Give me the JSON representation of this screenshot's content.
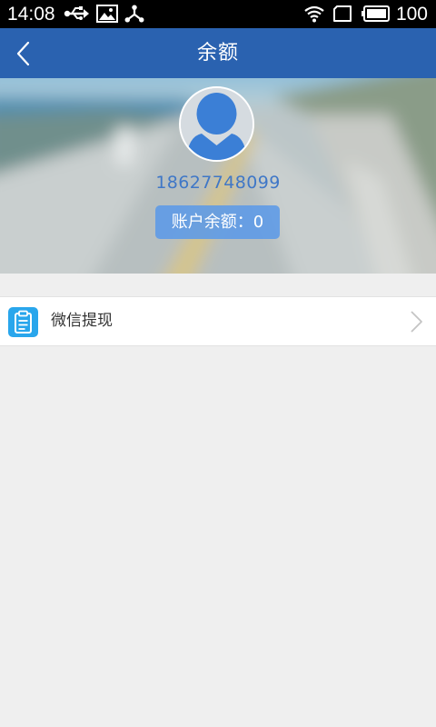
{
  "status_bar": {
    "time": "14:08",
    "battery": "100",
    "left_icons": [
      "usb-icon",
      "image-icon",
      "share-icon"
    ],
    "right_icons": [
      "wifi-icon",
      "sim-icon",
      "battery-icon"
    ]
  },
  "header": {
    "title": "余额",
    "back_icon": "chevron-left-icon",
    "background_color": "#2a62b0"
  },
  "account": {
    "phone": "18627748099",
    "balance_label": "账户余额：0",
    "avatar_icon": "user-avatar-icon"
  },
  "menu": {
    "items": [
      {
        "label": "微信提现",
        "icon": "clipboard-icon",
        "icon_color": "#29a6ec",
        "trailing_icon": "chevron-right-icon"
      }
    ]
  },
  "colors": {
    "accent": "#2a62b0",
    "phone_text": "#3f77c7",
    "badge": "#5c9ae7",
    "page_background": "#efefef"
  }
}
